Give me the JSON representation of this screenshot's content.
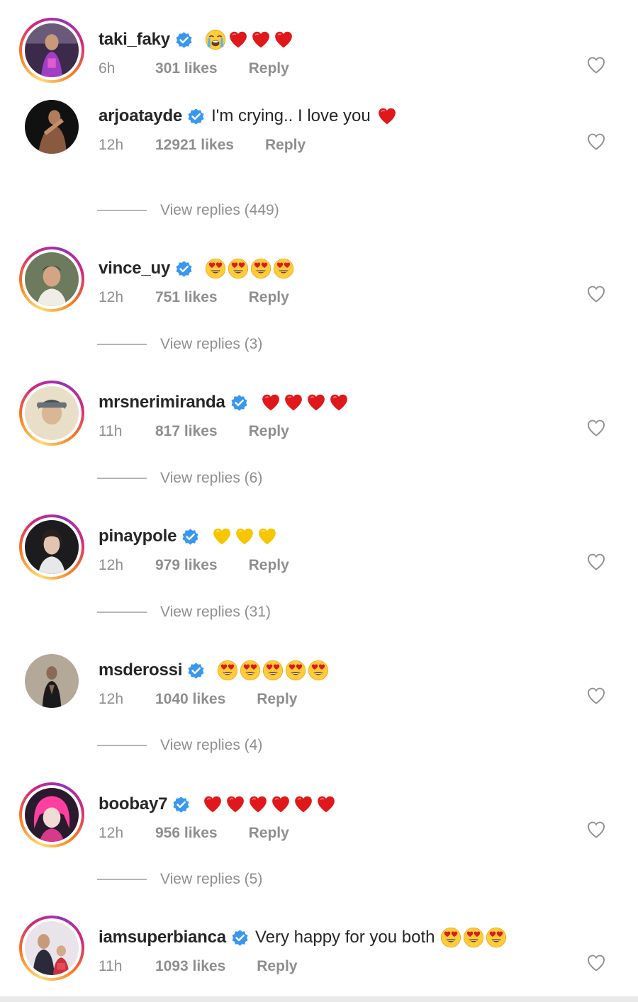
{
  "comments": [
    {
      "username": "taki_faky",
      "text": "",
      "time": "6h",
      "likes": "301 likes",
      "reply": "Reply",
      "emoji": [
        "crying-face",
        "red-heart",
        "red-heart",
        "red-heart"
      ],
      "view_replies": null,
      "avatar": "ring"
    },
    {
      "username": "arjoatayde",
      "text": "I'm crying.. I love you",
      "time": "12h",
      "likes": "12921 likes",
      "reply": "Reply",
      "emoji": [
        "red-heart"
      ],
      "view_replies": "View replies (449)",
      "avatar": "plain"
    },
    {
      "username": "vince_uy",
      "text": "",
      "time": "12h",
      "likes": "751 likes",
      "reply": "Reply",
      "emoji": [
        "heart-eyes",
        "heart-eyes",
        "heart-eyes",
        "heart-eyes"
      ],
      "view_replies": "View replies (3)",
      "avatar": "ring"
    },
    {
      "username": "mrsnerimiranda",
      "text": "",
      "time": "11h",
      "likes": "817 likes",
      "reply": "Reply",
      "emoji": [
        "red-heart",
        "red-heart",
        "red-heart",
        "red-heart"
      ],
      "view_replies": "View replies (6)",
      "avatar": "ring"
    },
    {
      "username": "pinaypole",
      "text": "",
      "time": "12h",
      "likes": "979 likes",
      "reply": "Reply",
      "emoji": [
        "yellow-heart",
        "yellow-heart",
        "yellow-heart"
      ],
      "view_replies": "View replies (31)",
      "avatar": "ring"
    },
    {
      "username": "msderossi",
      "text": "",
      "time": "12h",
      "likes": "1040 likes",
      "reply": "Reply",
      "emoji": [
        "heart-eyes",
        "heart-eyes",
        "heart-eyes",
        "heart-eyes",
        "heart-eyes"
      ],
      "view_replies": "View replies (4)",
      "avatar": "plain"
    },
    {
      "username": "boobay7",
      "text": "",
      "time": "12h",
      "likes": "956 likes",
      "reply": "Reply",
      "emoji": [
        "red-heart",
        "red-heart",
        "red-heart",
        "red-heart",
        "red-heart",
        "red-heart"
      ],
      "view_replies": "View replies (5)",
      "avatar": "ring"
    },
    {
      "username": "iamsuperbianca",
      "text": "Very happy for you both",
      "time": "11h",
      "likes": "1093 likes",
      "reply": "Reply",
      "emoji": [
        "heart-eyes",
        "heart-eyes",
        "heart-eyes"
      ],
      "view_replies": null,
      "avatar": "ring"
    }
  ],
  "colors": {
    "text_primary": "#262626",
    "text_secondary": "#8e8e8e",
    "verified_blue": "#3897f0",
    "heart_red": "#e0181b",
    "heart_yellow": "#f7c600"
  },
  "icons": {
    "verified": "verified-badge-icon",
    "like": "heart-outline-icon"
  }
}
